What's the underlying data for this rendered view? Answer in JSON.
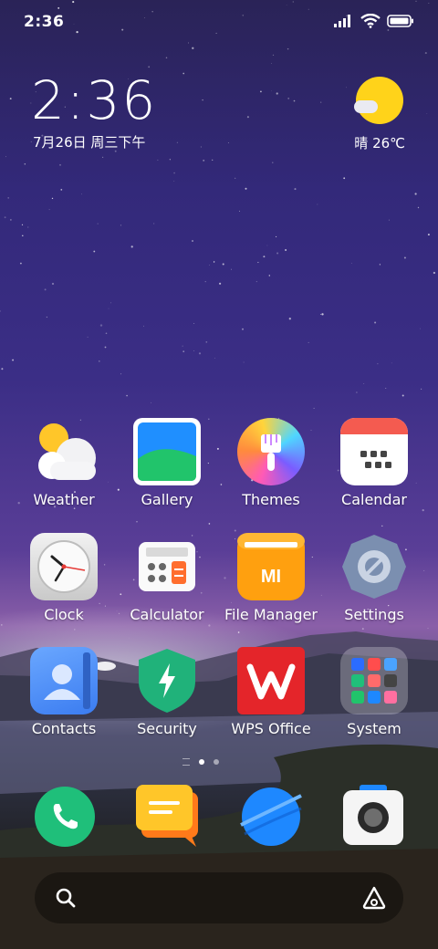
{
  "status_bar": {
    "time": "2:36"
  },
  "clock_widget": {
    "time": "2:36",
    "date": "7月26日 周三下午"
  },
  "weather_widget": {
    "text": "晴 26℃",
    "icon": "sun-cloud-icon"
  },
  "apps": [
    {
      "label": "Weather",
      "icon": "weather-icon"
    },
    {
      "label": "Gallery",
      "icon": "gallery-icon"
    },
    {
      "label": "Themes",
      "icon": "themes-icon"
    },
    {
      "label": "Calendar",
      "icon": "calendar-icon"
    },
    {
      "label": "Clock",
      "icon": "clock-icon"
    },
    {
      "label": "Calculator",
      "icon": "calculator-icon"
    },
    {
      "label": "File Manager",
      "icon": "file-manager-icon"
    },
    {
      "label": "Settings",
      "icon": "settings-icon"
    },
    {
      "label": "Contacts",
      "icon": "contacts-icon"
    },
    {
      "label": "Security",
      "icon": "security-icon"
    },
    {
      "label": "WPS Office",
      "icon": "wps-office-icon"
    },
    {
      "label": "System",
      "icon": "system-folder-icon"
    }
  ],
  "file_manager_badge": "MI",
  "page_indicator": {
    "pages": 2,
    "active": 1
  },
  "dock": [
    {
      "icon": "phone-icon"
    },
    {
      "icon": "messages-icon"
    },
    {
      "icon": "browser-icon"
    },
    {
      "icon": "camera-icon"
    }
  ],
  "search_bar": {
    "left_icon": "search-icon",
    "right_icon": "app-vault-icon"
  },
  "colors": {
    "accent_blue": "#1e88ff",
    "weather_sun": "#ffd31a",
    "security_green": "#20b27a",
    "wps_red": "#e4252a"
  }
}
